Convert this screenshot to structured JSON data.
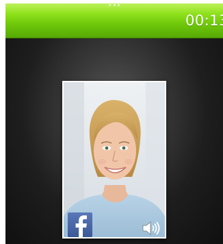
{
  "call": {
    "timer": "00:13"
  },
  "contact": {
    "photo_icon": "contact-photo",
    "social_icon": "facebook-icon",
    "audio_icon": "speaker-icon"
  },
  "colors": {
    "header_accent": "#8fe11c",
    "facebook_blue": "#3b5998"
  }
}
